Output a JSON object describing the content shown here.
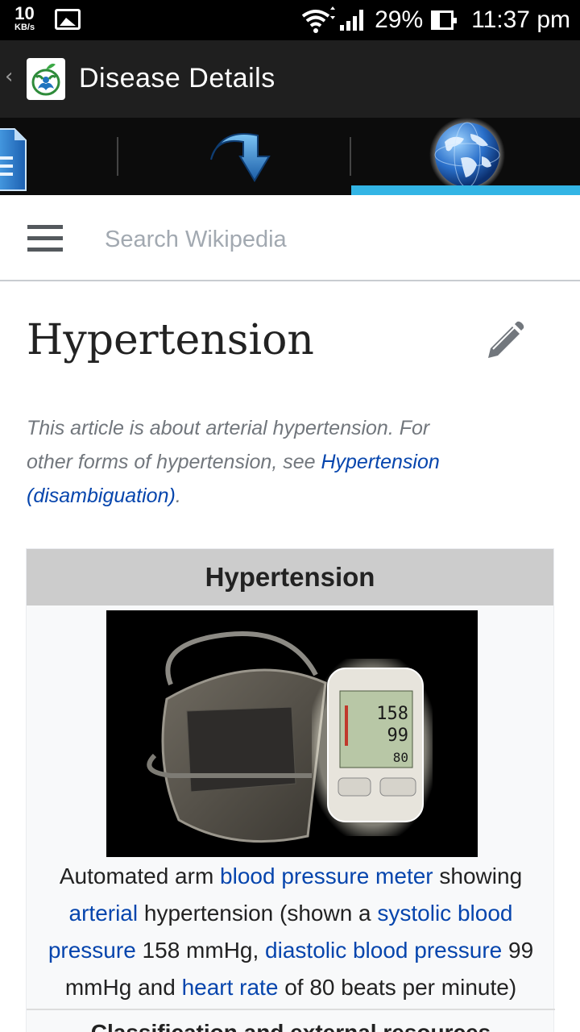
{
  "status_bar": {
    "net_speed_value": "10",
    "net_speed_unit": "KB/s",
    "battery_percent": "29%",
    "time": "11:37 pm"
  },
  "app_bar": {
    "title": "Disease Details",
    "back_glyph": "‹"
  },
  "tabs": [
    {
      "name": "document",
      "icon": "document-icon",
      "selected": false
    },
    {
      "name": "share",
      "icon": "curved-arrow-icon",
      "selected": false
    },
    {
      "name": "web",
      "icon": "globe-icon",
      "selected": true
    }
  ],
  "colors": {
    "tab_indicator": "#33b5e5",
    "link": "#0645ad",
    "app_bar_bg": "#1f1f1f"
  },
  "wiki": {
    "search_placeholder": "Search Wikipedia"
  },
  "article": {
    "title": "Hypertension",
    "hatnote": {
      "text": "This article is about arterial hypertension. For other forms of hypertension, see ",
      "link": "Hypertension (disambiguation)",
      "end": "."
    },
    "infobox": {
      "title": "Hypertension",
      "image_readings": {
        "systolic": "158",
        "diastolic": "99",
        "pulse": "80"
      },
      "caption": {
        "t1": "Automated arm ",
        "l1": "blood pressure meter",
        "t2": " showing ",
        "l2": "arterial",
        "t3": " hypertension (shown a ",
        "l3": "systolic blood pressure",
        "t4": " 158 mmHg, ",
        "l4": "diastolic blood pressure",
        "t5": " 99 mmHg and ",
        "l5": "heart rate",
        "t6": " of 80 beats per minute)"
      },
      "section_heading": "Classification and external resources"
    }
  }
}
